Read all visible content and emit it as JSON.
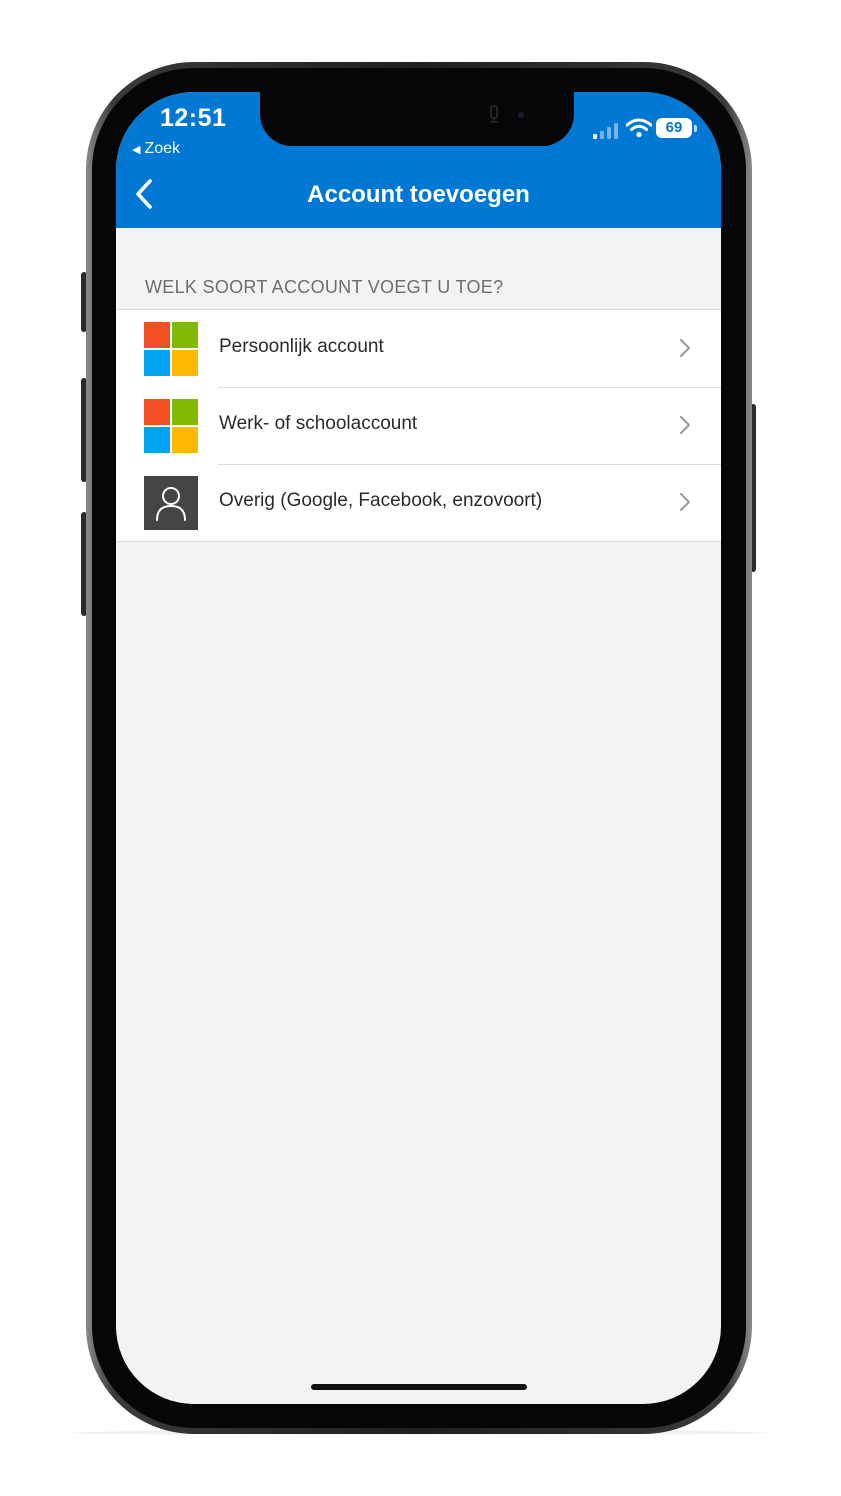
{
  "status_bar": {
    "time": "12:51",
    "back_app_label": "Zoek",
    "back_app_icon": "left-triangle-icon",
    "battery_level": "69",
    "signal_bars_active": 1,
    "signal_bars_total": 4
  },
  "nav": {
    "back_icon": "chevron-left-icon",
    "title": "Account toevoegen"
  },
  "section": {
    "header": "WELK SOORT ACCOUNT VOEGT U TOE?"
  },
  "options": [
    {
      "label": "Persoonlijk account",
      "icon": "microsoft-logo-icon"
    },
    {
      "label": "Werk- of schoolaccount",
      "icon": "microsoft-logo-icon"
    },
    {
      "label": "Overig (Google, Facebook, enzovoort)",
      "icon": "person-icon"
    }
  ],
  "colors": {
    "header_blue": "#0078d4",
    "background": "#f3f3f3",
    "ms_red": "#f25022",
    "ms_green": "#7fba00",
    "ms_blue": "#00a4ef",
    "ms_yellow": "#ffb900",
    "person_tile": "#454545"
  }
}
